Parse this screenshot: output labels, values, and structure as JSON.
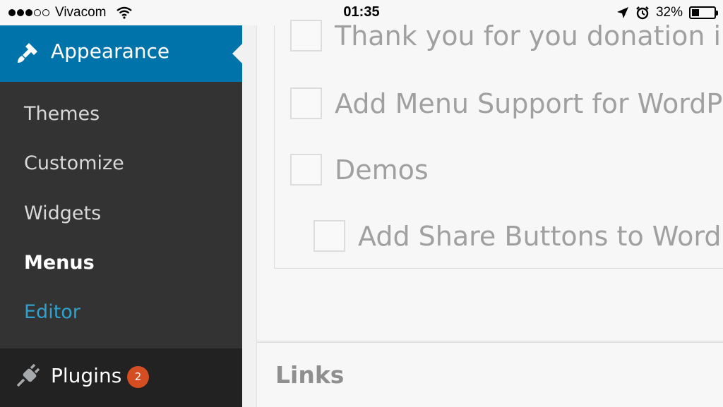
{
  "status_bar": {
    "carrier": "Vivacom",
    "time": "01:35",
    "battery_percent": "32%",
    "battery_level": 0.32,
    "signal_dots_filled": 3,
    "signal_dots_total": 5,
    "icons": [
      "wifi-icon",
      "location-arrow-icon",
      "alarm-icon",
      "battery-icon"
    ]
  },
  "sidebar": {
    "appearance": {
      "label": "Appearance",
      "icon": "paintbrush-icon"
    },
    "submenu": [
      {
        "label": "Themes"
      },
      {
        "label": "Customize"
      },
      {
        "label": "Widgets"
      },
      {
        "label": "Menus",
        "current": true
      },
      {
        "label": "Editor",
        "highlighted": true
      }
    ],
    "plugins": {
      "label": "Plugins",
      "icon": "plug-icon",
      "badge": "2"
    }
  },
  "main": {
    "items": [
      {
        "label": "Thank you for you donation i a"
      },
      {
        "label": "Add Menu Support for WordPr"
      },
      {
        "label": "Demos"
      },
      {
        "label": "Add Share Buttons to WordPr"
      }
    ],
    "links_title": "Links"
  },
  "colors": {
    "accent": "#0073aa",
    "sidebar_bg": "#333333",
    "plugins_bg": "#222222",
    "highlight": "#2ea2cc",
    "badge": "#d54e21"
  }
}
